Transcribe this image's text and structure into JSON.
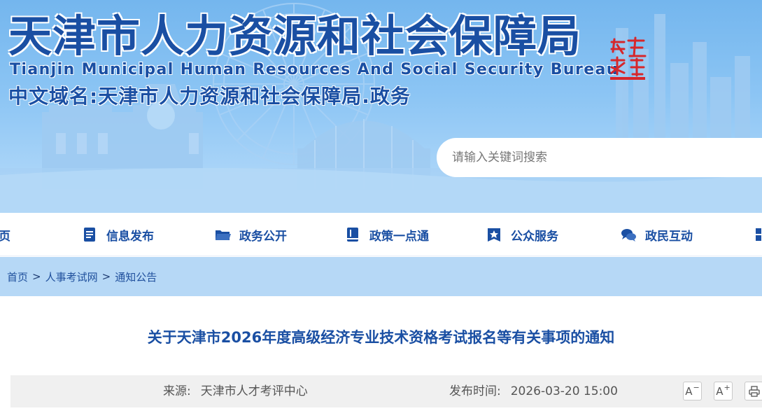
{
  "header": {
    "title_cn": "天津市人力资源和社会保障局",
    "title_en": "Tianjin Municipal Human Resources And Social Security Bureau",
    "domain_line": "中文域名:天津市人力资源和社会保障局.政务",
    "seal_alt": "天津 政务"
  },
  "search": {
    "placeholder": "请输入关键词搜索"
  },
  "nav": {
    "items": [
      {
        "label": "页",
        "icon": "home-icon"
      },
      {
        "label": "信息发布",
        "icon": "document-icon"
      },
      {
        "label": "政务公开",
        "icon": "folder-icon"
      },
      {
        "label": "政策一点通",
        "icon": "book-icon"
      },
      {
        "label": "公众服务",
        "icon": "star-badge-icon"
      },
      {
        "label": "政民互动",
        "icon": "chat-icon"
      }
    ]
  },
  "breadcrumb": {
    "items": [
      "首页",
      "人事考试网",
      "通知公告"
    ],
    "separator": ">"
  },
  "article": {
    "title": "关于天津市2026年度高级经济专业技术资格考试报名等有关事项的通知",
    "source_label": "来源:",
    "source_value": "天津市人才考评中心",
    "date_label": "发布时间:",
    "date_value": "2026-03-20 15:00",
    "font_smaller": "A",
    "font_smaller_mark": "−",
    "font_larger": "A",
    "font_larger_mark": "+"
  },
  "colors": {
    "brand_blue": "#1a4fa3",
    "banner_top": "#74b6ee",
    "crumb_bg": "#b6d8f6",
    "meta_bg": "#f0f0f0",
    "seal_red": "#d6262b"
  }
}
